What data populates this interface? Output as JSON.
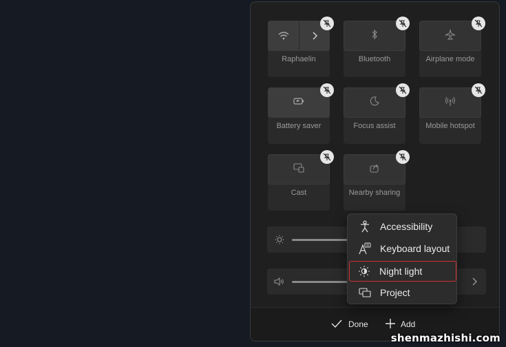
{
  "tiles": [
    {
      "label": "Raphaelin",
      "icon": "wifi-icon"
    },
    {
      "label": "Bluetooth",
      "icon": "bluetooth-icon"
    },
    {
      "label": "Airplane mode",
      "icon": "airplane-icon"
    },
    {
      "label": "Battery saver",
      "icon": "battery-saver-icon"
    },
    {
      "label": "Focus assist",
      "icon": "moon-icon"
    },
    {
      "label": "Mobile hotspot",
      "icon": "hotspot-icon"
    },
    {
      "label": "Cast",
      "icon": "cast-icon"
    },
    {
      "label": "Nearby sharing",
      "icon": "share-icon"
    }
  ],
  "menu": {
    "items": [
      {
        "label": "Accessibility",
        "icon": "accessibility-icon"
      },
      {
        "label": "Keyboard layout",
        "icon": "keyboard-layout-icon"
      },
      {
        "label": "Night light",
        "icon": "night-light-icon",
        "highlighted": true
      },
      {
        "label": "Project",
        "icon": "project-icon"
      }
    ]
  },
  "footer": {
    "done_label": "Done",
    "add_label": "Add"
  },
  "watermark": "shenmazhishi.com"
}
